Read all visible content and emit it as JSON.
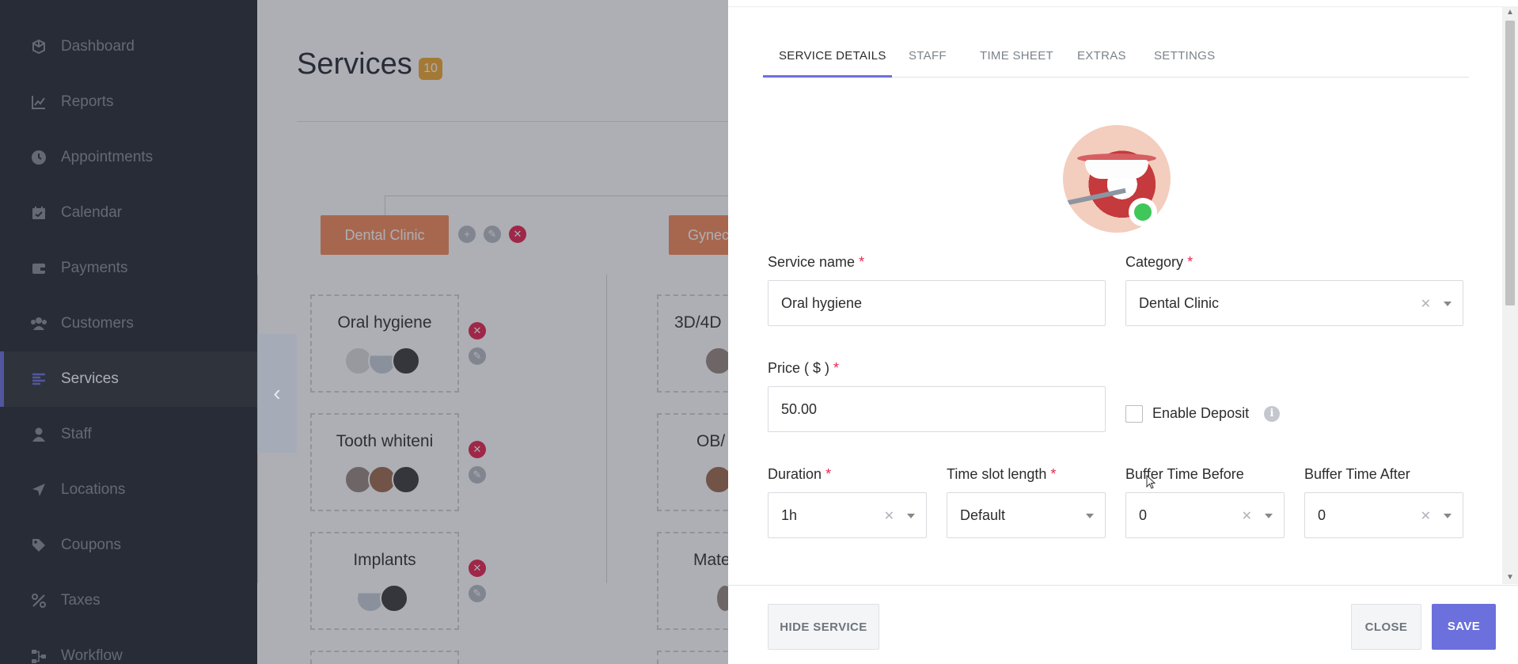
{
  "sidebar": {
    "items": [
      {
        "label": "Dashboard",
        "icon": "cube-icon"
      },
      {
        "label": "Reports",
        "icon": "chart-line-icon"
      },
      {
        "label": "Appointments",
        "icon": "clock-icon"
      },
      {
        "label": "Calendar",
        "icon": "calendar-icon"
      },
      {
        "label": "Payments",
        "icon": "wallet-icon"
      },
      {
        "label": "Customers",
        "icon": "users-icon"
      },
      {
        "label": "Services",
        "icon": "list-icon"
      },
      {
        "label": "Staff",
        "icon": "user-icon"
      },
      {
        "label": "Locations",
        "icon": "location-arrow-icon"
      },
      {
        "label": "Coupons",
        "icon": "tag-icon"
      },
      {
        "label": "Taxes",
        "icon": "percent-icon"
      },
      {
        "label": "Workflow",
        "icon": "workflow-icon"
      }
    ],
    "active": "Services",
    "accent_color": "#6c70dc"
  },
  "background": {
    "title": "Services",
    "count": "10",
    "categories": [
      "Dental Clinic",
      "Gynec"
    ],
    "services_left": [
      "Oral hygiene",
      "Tooth whiteni",
      "Implants"
    ],
    "services_right": [
      "3D/4D",
      "OB/",
      "Mate"
    ],
    "category_color": "#f58b5a"
  },
  "panel": {
    "tabs": [
      "SERVICE DETAILS",
      "STAFF",
      "TIME SHEET",
      "EXTRAS",
      "SETTINGS"
    ],
    "active_tab": "SERVICE DETAILS",
    "fields": {
      "service_name": {
        "label": "Service name",
        "value": "Oral hygiene"
      },
      "category": {
        "label": "Category",
        "value": "Dental Clinic"
      },
      "price": {
        "label": "Price ( $ )",
        "value": "50.00"
      },
      "enable_deposit": {
        "label": "Enable Deposit",
        "checked": false
      },
      "duration": {
        "label": "Duration",
        "value": "1h"
      },
      "time_slot_length": {
        "label": "Time slot length",
        "value": "Default"
      },
      "buffer_before": {
        "label": "Buffer Time Before",
        "value": "0"
      },
      "buffer_after": {
        "label": "Buffer Time After",
        "value": "0"
      }
    },
    "required_mark": "*",
    "status_color": "#3fc75a",
    "buttons": {
      "hide": "HIDE SERVICE",
      "close": "CLOSE",
      "save": "SAVE"
    }
  }
}
